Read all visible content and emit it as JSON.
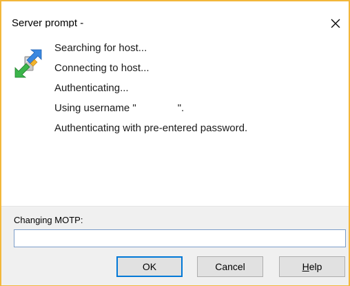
{
  "dialog": {
    "title": "Server prompt -",
    "close_icon": "close-icon",
    "app_icon": "connection-arrows-icon"
  },
  "messages": [
    "Searching for host...",
    "Connecting to host...",
    "Authenticating...",
    "Using username \"",
    "Authenticating with pre-entered password."
  ],
  "username_suffix": "\".",
  "prompt": {
    "label": "Changing MOTP:",
    "value": ""
  },
  "buttons": {
    "ok": "OK",
    "cancel": "Cancel",
    "help_mnemonic": "H",
    "help_rest": "elp"
  },
  "colors": {
    "window_border": "#f3b73a",
    "focus_accent": "#0078d7",
    "input_border": "#7a9cc8",
    "panel_bg": "#f0f0f0"
  }
}
